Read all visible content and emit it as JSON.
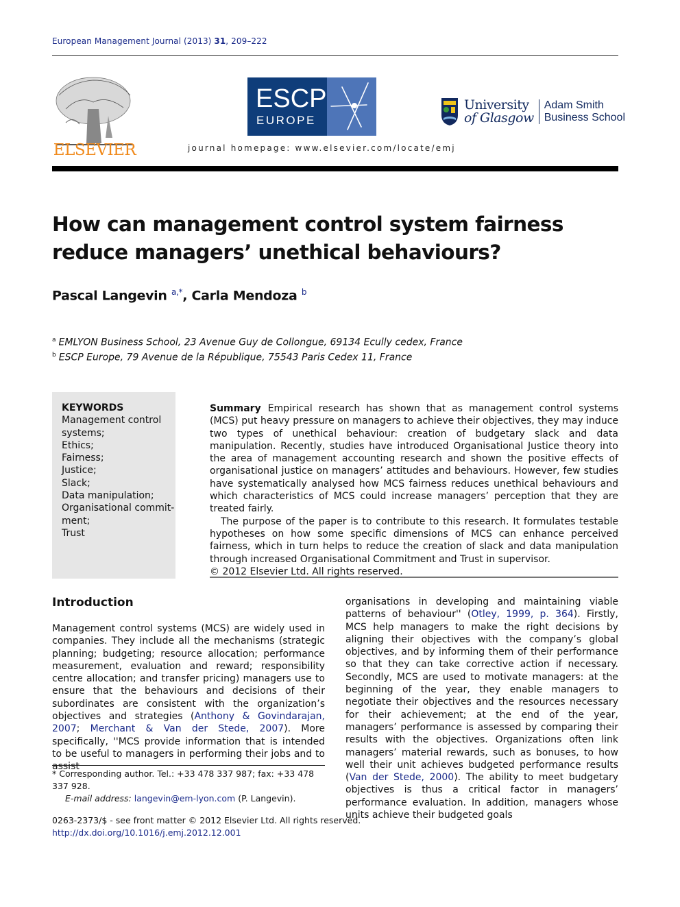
{
  "header": {
    "journal_name": "European Management Journal (2013)",
    "volume": "31",
    "pages": ", 209–222",
    "homepage": "journal homepage: www.elsevier.com/locate/emj",
    "publisher_logo_text": "ELSEVIER",
    "escp_logo": {
      "line1": "ESCP",
      "line2": "EUROPE"
    },
    "glasgow_logo": {
      "line1": "University",
      "line2": "of Glasgow",
      "school_line1": "Adam Smith",
      "school_line2": "Business School"
    }
  },
  "article": {
    "title": "How can management control system fairness reduce managers’ unethical behaviours?",
    "authors": [
      {
        "name": "Pascal Langevin",
        "affil": "a,*"
      },
      {
        "name": "Carla Mendoza",
        "affil": "b"
      }
    ],
    "affiliations": [
      {
        "mark": "a",
        "text": "EMLYON Business School, 23 Avenue Guy de Collongue, 69134 Ecully cedex, France"
      },
      {
        "mark": "b",
        "text": "ESCP Europe, 79 Avenue de la République, 75543 Paris Cedex 11, France"
      }
    ]
  },
  "keywords": {
    "title": "KEYWORDS",
    "items": [
      "Management control systems;",
      "Ethics;",
      "Fairness;",
      "Justice;",
      "Slack;",
      "Data manipulation;",
      "Organisational commit-ment;",
      "Trust"
    ]
  },
  "summary": {
    "label": "Summary",
    "p1": "Empirical research has shown that as management control systems (MCS) put heavy pressure on managers to achieve their objectives, they may induce two types of unethical behaviour: creation of budgetary slack and data manipulation. Recently, studies have introduced Organisational Justice theory into the area of management accounting research and shown the positive effects of organisational justice on managers’ attitudes and behaviours. However, few studies have systematically analysed how MCS fairness reduces unethical behaviours and which characteristics of MCS could increase managers’ perception that they are treated fairly.",
    "p2": "The purpose of the paper is to contribute to this research. It formulates testable hypotheses on how some specific dimensions of MCS can enhance perceived fairness, which in turn helps to reduce the creation of slack and data manipulation through increased Organisational Commitment and Trust in supervisor.",
    "copyright": "© 2012 Elsevier Ltd. All rights reserved."
  },
  "introduction": {
    "heading": "Introduction",
    "col1_a": "Management control systems (MCS) are widely used in companies. They include all the mechanisms (strategic planning; budgeting; resource allocation; performance measurement, evaluation and reward; responsibility centre allocation; and transfer pricing) managers use to ensure that the behaviours and decisions of their subordinates are consistent with the organization’s objectives and strategies (",
    "cite1": "Anthony & Govindarajan, 2007",
    "col1_b": "; ",
    "cite2": "Merchant & Van der Stede, 2007",
    "col1_c": "). More specifically, ''MCS provide information that is intended to be useful to managers in performing their jobs and to assist",
    "col2_a": "organisations in developing and maintaining viable patterns of behaviour'' (",
    "cite3": "Otley, 1999, p. 364",
    "col2_b": "). Firstly, MCS help managers to make the right decisions by aligning their objectives with the company’s global objectives, and by informing them of their performance so that they can take corrective action if necessary. Secondly, MCS are used to motivate managers: at the beginning of the year, they enable managers to negotiate their objectives and the resources necessary for their achievement; at the end of the year, managers’ performance is assessed by comparing their results with the objectives. Organizations often link managers’ material rewards, such as bonuses, to how well their unit achieves budgeted performance results (",
    "cite4": "Van der Stede, 2000",
    "col2_c": "). The ability to meet budgetary objectives is thus a critical factor in managers’ performance evaluation. In addition, managers whose units achieve their budgeted goals"
  },
  "footnotes": {
    "corresponding": "* Corresponding author. Tel.: +33 478 337 987; fax: +33 478 337 928.",
    "email_label": "E-mail address:",
    "email": "langevin@em-lyon.com",
    "email_suffix": " (P. Langevin)."
  },
  "bottom": {
    "issn": "0263-2373/$ - see front matter © 2012 Elsevier Ltd. All rights reserved.",
    "doi": "http://dx.doi.org/10.1016/j.emj.2012.12.001"
  },
  "colors": {
    "link": "#1a2a8a",
    "elsevier_orange": "#f08a1c",
    "escp_dark": "#0f3d7a",
    "escp_light": "#4e75b8",
    "keywords_bg": "#e6e6e6"
  }
}
